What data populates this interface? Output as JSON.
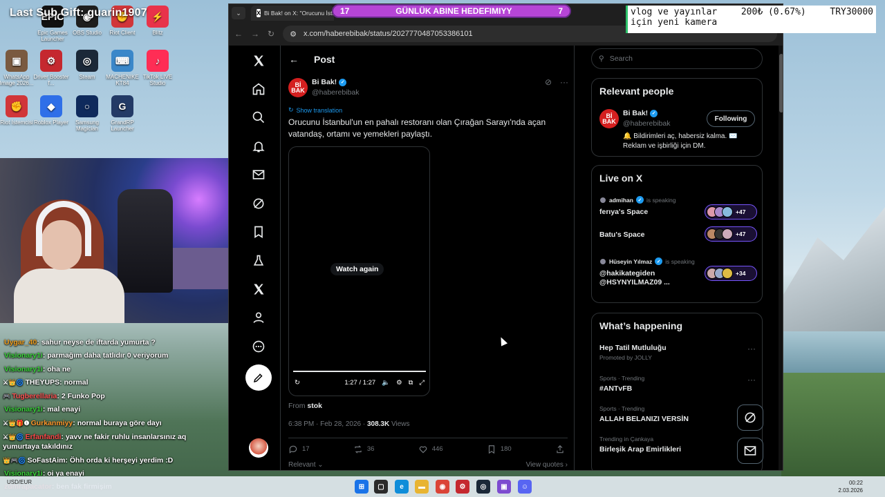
{
  "stream": {
    "overlay_title": "Last Sub Gift: guarin1907",
    "goal_left": "17",
    "goal_title": "GÜNLÜK ABINE HEDEFIMIYY",
    "goal_right": "7",
    "sub_goal_line1_a": "vlog ve yayınlar",
    "sub_goal_line1_b": "200₺ (0.67%)",
    "sub_goal_line1_c": "TRY30000",
    "sub_goal_line2": "için yeni kamera"
  },
  "desktop_icons": [
    {
      "label": "Epic Games Launcher",
      "icon": "epic-games-icon",
      "color": "#111111",
      "glyph": "EPIC"
    },
    {
      "label": "OBS Studio",
      "icon": "obs-icon",
      "color": "#1e1e1e",
      "glyph": "◉"
    },
    {
      "label": "Riot Client",
      "icon": "riot-icon",
      "color": "#d13639",
      "glyph": "✊"
    },
    {
      "label": "Blitz",
      "icon": "blitz-icon",
      "color": "#e8334a",
      "glyph": "⚡"
    },
    {
      "label": "WhatsApp Image 2026...",
      "icon": "image-file-icon",
      "color": "#7a5a40",
      "glyph": "▣"
    },
    {
      "label": "Driver Booster f...",
      "icon": "driver-booster-icon",
      "color": "#c5282f",
      "glyph": "⚙"
    },
    {
      "label": "Steam",
      "icon": "steam-icon",
      "color": "#1b2838",
      "glyph": "◎"
    },
    {
      "label": "MACHENIKE KT84",
      "icon": "machenike-icon",
      "color": "#3a87c9",
      "glyph": "⌨"
    },
    {
      "label": "TikTok LIVE Studio",
      "icon": "tiktok-icon",
      "color": "#ff2d55",
      "glyph": "♪"
    },
    {
      "label": "Riot İstemcisi",
      "icon": "riot-client-icon",
      "color": "#d13639",
      "glyph": "✊"
    },
    {
      "label": "Roblox Player",
      "icon": "roblox-icon",
      "color": "#2f6fe8",
      "glyph": "◆"
    },
    {
      "label": "Samsung Magician",
      "icon": "samsung-magician-icon",
      "color": "#0f2a5c",
      "glyph": "○"
    },
    {
      "label": "GrandRP Launcher",
      "icon": "grandrp-icon",
      "color": "#233a66",
      "glyph": "G"
    }
  ],
  "chat": [
    {
      "badges": "",
      "user": "Uygar_40",
      "color": "#f0a020",
      "msg": "sahur neyse de iftarda yumurta ?"
    },
    {
      "badges": "",
      "user": "Visionary1i",
      "color": "#3ad43a",
      "msg": "parmağım daha tatlıdır 0 veriyorum"
    },
    {
      "badges": "",
      "user": "Visionary1i",
      "color": "#3ad43a",
      "msg": "oha ne"
    },
    {
      "badges": "⚔👑🌀",
      "user": "THEYUPS",
      "color": "#ffffff",
      "msg": "normal"
    },
    {
      "badges": "🎮",
      "user": "Tugberellaria",
      "color": "#ff5555",
      "msg": "2 Funko Pop"
    },
    {
      "badges": "",
      "user": "Visionary1i",
      "color": "#3ad43a",
      "msg": "mal enayi"
    },
    {
      "badges": "⚔👑🎁❶",
      "user": "Gurkanmiyy",
      "color": "#ff9a2e",
      "msg": "normal buraya göre dayı"
    },
    {
      "badges": "⚔👑🌀",
      "user": "Erfanfandi",
      "color": "#ff4a4a",
      "msg": "yavv ne fakir ruhlu insanlarsınız aq yumurtaya takıldınız"
    },
    {
      "badges": "👑🎮🌀",
      "user": "SoFastAim",
      "color": "#ffffff",
      "msg": "Öhh orda ki herşeyi yerdim :D"
    },
    {
      "badges": "",
      "user": "Visionary1i",
      "color": "#3ad43a",
      "msg": "oi ya enayi"
    },
    {
      "badges": "",
      "user": "zümrapacator",
      "color": "#ff6a6a",
      "msg": "ben fak firmişim"
    }
  ],
  "browser": {
    "tab_title": "Bi Bak! on X: \"Orucunu İstanb...",
    "url": "x.com/haberebibak/status/2027770487053386101"
  },
  "x": {
    "post_header": "Post",
    "author_name": "Bi Bak!",
    "author_handle": "@haberebibak",
    "avatar_text": "Bİ BAK",
    "show_translation": "Show translation",
    "post_text": "Orucunu İstanbul'un en pahalı restoranı olan Çırağan Sarayı'nda açan vatandaş, ortamı ve yemekleri paylaştı.",
    "watch_again": "Watch again",
    "video_time": "1:27 / 1:27",
    "video_progress": 1.0,
    "from_label": "From",
    "from_source": "stok",
    "timestamp": "6:38 PM · Feb 28, 2026 · ",
    "views_count": "308.3K",
    "views_label": " Views",
    "replies": "17",
    "reposts": "36",
    "likes": "446",
    "bookmarks": "180",
    "relevant_label": "Relevant",
    "view_quotes": "View quotes",
    "search_placeholder": "Search",
    "relevant_people_title": "Relevant people",
    "following_button": "Following",
    "bio": "🔔 Bildirimleri aç, habersiz kalma. ✉️ Reklam ve işbirliği için DM.",
    "live_title": "Live on X",
    "spaces": [
      {
        "host": "admihan",
        "speaking": "is speaking",
        "title": "ferıya's Space",
        "count": "+47"
      },
      {
        "host": "",
        "speaking": "",
        "title": "Batu's Space",
        "count": "+47"
      },
      {
        "host": "Hüseyin Yılmaz",
        "speaking": "is speaking",
        "title": "@hakikategiden @HSYNYILMAZ09 ...",
        "count": "+34"
      }
    ],
    "happening_title": "What’s happening",
    "trends": [
      {
        "meta": "",
        "name": "Hep Tatil Mutluluğu",
        "sub": "Promoted by JOLLY"
      },
      {
        "meta": "Sports · Trending",
        "name": "#ANTvFB",
        "sub": ""
      },
      {
        "meta": "Sports · Trending",
        "name": "ALLAH BELANIZI VERSİN",
        "sub": ""
      },
      {
        "meta": "Trending in Çankaya",
        "name": "Birleşik Arap Emirlikleri",
        "sub": ""
      }
    ]
  },
  "taskbar": {
    "weather_line1": "USD/EUR",
    "weather_line2": "",
    "time": "00:22",
    "date": "2.03.2026"
  }
}
